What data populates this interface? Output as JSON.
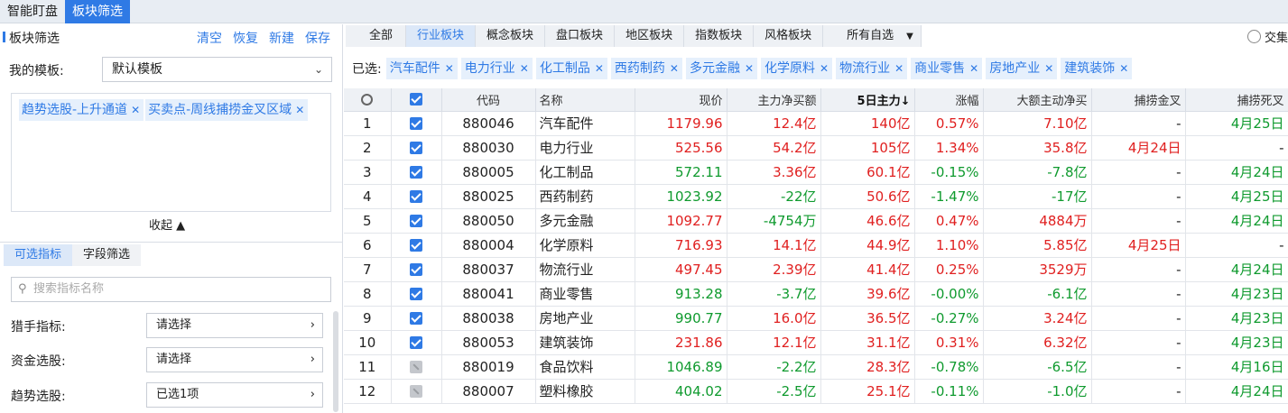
{
  "top_tabs": [
    "智能盯盘",
    "板块筛选"
  ],
  "left": {
    "title": "板块筛选",
    "actions": [
      "清空",
      "恢复",
      "新建",
      "保存"
    ],
    "template_label": "我的模板:",
    "template_value": "默认模板",
    "chips": [
      "趋势选股-上升通道",
      "买卖点-周线捕捞金叉区域"
    ],
    "collapse_label": "收起 ▲",
    "subtabs": [
      "可选指标",
      "字段筛选"
    ],
    "search_placeholder": "搜索指标名称",
    "indicators": [
      {
        "label": "猎手指标:",
        "value": "请选择"
      },
      {
        "label": "资金选股:",
        "value": "请选择"
      },
      {
        "label": "趋势选股:",
        "value": "已选1项"
      }
    ]
  },
  "categories": [
    "全部",
    "行业板块",
    "概念板块",
    "盘口板块",
    "地区板块",
    "指数板块",
    "风格板块",
    "所有自选"
  ],
  "jiaoji_label": "交集",
  "selected_label": "已选:",
  "selected_chips": [
    "汽车配件",
    "电力行业",
    "化工制品",
    "西药制药",
    "多元金融",
    "化学原料",
    "物流行业",
    "商业零售",
    "房地产业",
    "建筑装饰"
  ],
  "columns": [
    "代码",
    "名称",
    "现价",
    "主力净买额",
    "5日主力↓",
    "涨幅",
    "大额主动净买",
    "捕捞金叉",
    "捕捞死叉"
  ],
  "colors": {
    "up": "#e02020",
    "down": "#0f9a2e",
    "accent": "#2f7ae5"
  },
  "rows": [
    {
      "idx": "1",
      "checked": true,
      "code": "880046",
      "name": "汽车配件",
      "price": "1179.96",
      "net": "12.4亿",
      "five": "140亿",
      "chg": "0.57%",
      "large": "7.10亿",
      "gold": "-",
      "dead": "4月25日"
    },
    {
      "idx": "2",
      "checked": true,
      "code": "880030",
      "name": "电力行业",
      "price": "525.56",
      "net": "54.2亿",
      "five": "105亿",
      "chg": "1.34%",
      "large": "35.8亿",
      "gold": "4月24日",
      "dead": "-"
    },
    {
      "idx": "3",
      "checked": true,
      "code": "880005",
      "name": "化工制品",
      "price": "572.11",
      "net": "3.36亿",
      "five": "60.1亿",
      "chg": "-0.15%",
      "large": "-7.8亿",
      "gold": "-",
      "dead": "4月24日"
    },
    {
      "idx": "4",
      "checked": true,
      "code": "880025",
      "name": "西药制药",
      "price": "1023.92",
      "net": "-22亿",
      "five": "50.6亿",
      "chg": "-1.47%",
      "large": "-17亿",
      "gold": "-",
      "dead": "4月25日"
    },
    {
      "idx": "5",
      "checked": true,
      "code": "880050",
      "name": "多元金融",
      "price": "1092.77",
      "net": "-4754万",
      "five": "46.6亿",
      "chg": "0.47%",
      "large": "4884万",
      "gold": "-",
      "dead": "4月24日"
    },
    {
      "idx": "6",
      "checked": true,
      "code": "880004",
      "name": "化学原料",
      "price": "716.93",
      "net": "14.1亿",
      "five": "44.9亿",
      "chg": "1.10%",
      "large": "5.85亿",
      "gold": "4月25日",
      "dead": "-"
    },
    {
      "idx": "7",
      "checked": true,
      "code": "880037",
      "name": "物流行业",
      "price": "497.45",
      "net": "2.39亿",
      "five": "41.4亿",
      "chg": "0.25%",
      "large": "3529万",
      "gold": "-",
      "dead": "4月24日"
    },
    {
      "idx": "8",
      "checked": true,
      "code": "880041",
      "name": "商业零售",
      "price": "913.28",
      "net": "-3.7亿",
      "five": "39.6亿",
      "chg": "-0.00%",
      "large": "-6.1亿",
      "gold": "-",
      "dead": "4月23日"
    },
    {
      "idx": "9",
      "checked": true,
      "code": "880038",
      "name": "房地产业",
      "price": "990.77",
      "net": "16.0亿",
      "five": "36.5亿",
      "chg": "-0.27%",
      "large": "3.24亿",
      "gold": "-",
      "dead": "4月23日"
    },
    {
      "idx": "10",
      "checked": true,
      "code": "880053",
      "name": "建筑装饰",
      "price": "231.86",
      "net": "12.1亿",
      "five": "31.1亿",
      "chg": "0.31%",
      "large": "6.32亿",
      "gold": "-",
      "dead": "4月23日"
    },
    {
      "idx": "11",
      "checked": false,
      "code": "880019",
      "name": "食品饮料",
      "price": "1046.89",
      "net": "-2.2亿",
      "five": "28.3亿",
      "chg": "-0.78%",
      "large": "-6.5亿",
      "gold": "-",
      "dead": "4月16日"
    },
    {
      "idx": "12",
      "checked": false,
      "code": "880007",
      "name": "塑料橡胶",
      "price": "404.02",
      "net": "-2.5亿",
      "five": "25.1亿",
      "chg": "-0.11%",
      "large": "-1.0亿",
      "gold": "-",
      "dead": "4月24日"
    }
  ]
}
